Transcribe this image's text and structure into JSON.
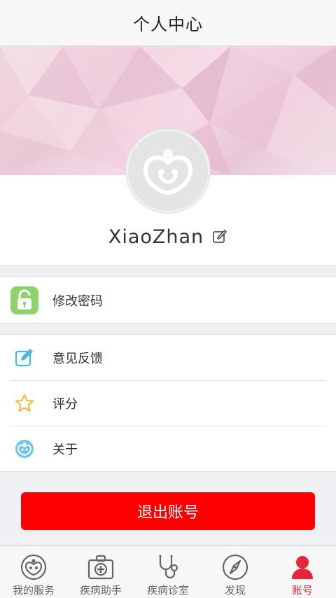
{
  "header": {
    "title": "个人中心"
  },
  "profile": {
    "username": "XiaoZhan"
  },
  "security_group": {
    "items": [
      {
        "label": "修改密码",
        "icon": "lock-icon"
      }
    ]
  },
  "misc_group": {
    "items": [
      {
        "label": "意见反馈",
        "icon": "feedback-edit-icon"
      },
      {
        "label": "评分",
        "icon": "star-icon"
      },
      {
        "label": "关于",
        "icon": "app-logo-icon"
      }
    ]
  },
  "logout": {
    "label": "退出账号"
  },
  "tabbar": {
    "items": [
      {
        "label": "我的服务",
        "icon": "service-logo-icon"
      },
      {
        "label": "疾病助手",
        "icon": "medical-kit-icon"
      },
      {
        "label": "疾病诊室",
        "icon": "stethoscope-icon"
      },
      {
        "label": "发现",
        "icon": "compass-icon"
      },
      {
        "label": "账号",
        "icon": "user-icon",
        "active": true
      }
    ]
  },
  "colors": {
    "accent_red": "#ff0000",
    "active_tab": "#e8243b",
    "lock_green": "#8ed36a"
  }
}
